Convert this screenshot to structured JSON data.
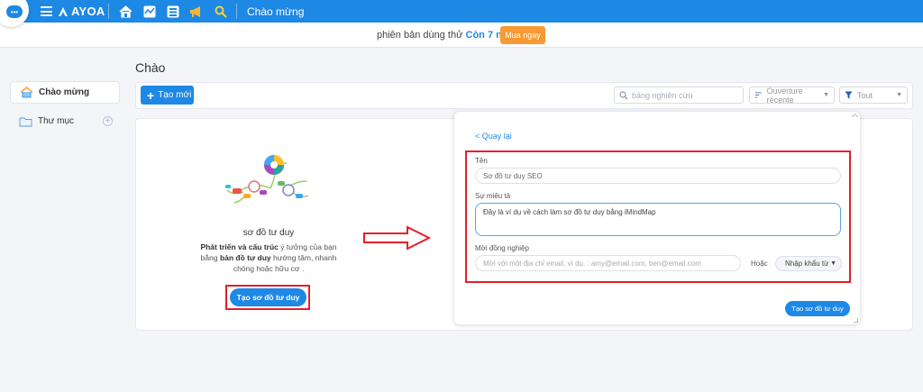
{
  "topbar": {
    "logo_text": "AYOA",
    "title": "Chào mừng",
    "chat_icon_text": "•••",
    "nav_icons": [
      "home-icon",
      "activity-icon",
      "board-icon",
      "megaphone-icon",
      "search-icon"
    ],
    "color": "#1e88e5"
  },
  "trial": {
    "prefix": "phiên bản dùng thử",
    "highlight": "Còn 7 ngày",
    "buy_label": "Mua ngay",
    "buy_color": "#f79a33"
  },
  "sidebar": {
    "items": [
      {
        "label": "Chào mừng",
        "icon": "home-icon"
      },
      {
        "label": "Thư mục",
        "icon": "folder-icon"
      }
    ],
    "add_label": "+"
  },
  "main": {
    "page_title": "Chào",
    "new_button": {
      "icon": "+",
      "label": "Tạo mới"
    },
    "search_placeholder": "bảng nghiên cứu",
    "sort_label": "Ouverture récente",
    "filter_label": "Tout"
  },
  "mindmap": {
    "title": "sơ đồ tư duy",
    "desc_1": "Phát triển và cấu trúc",
    "desc_2": " ý tưởng của bạn bằng ",
    "desc_3": "bản đồ tư duy",
    "desc_4": " hướng tâm, nhanh chóng hoặc hữu cơ .",
    "create_button": "Tạo sơ đồ tư duy"
  },
  "form": {
    "back_label": "< Quay lại",
    "name_label": "Tên",
    "name_value": "Sơ đồ tư duy SEO",
    "desc_label": "Sự miêu tả",
    "desc_value": "Đây là ví dụ về cách làm sơ đồ tư duy bằng iMindMap",
    "invite_label": "Mời đồng nghiệp",
    "invite_placeholder": "Mời với một địa chỉ email, ví dụ.  : amy@email.com, ben@email.com",
    "or_label": "Hoặc",
    "import_label": "Nhập khẩu từ",
    "submit_label": "Tạo sơ đồ tư duy"
  },
  "annotation_color": "#e3202a"
}
